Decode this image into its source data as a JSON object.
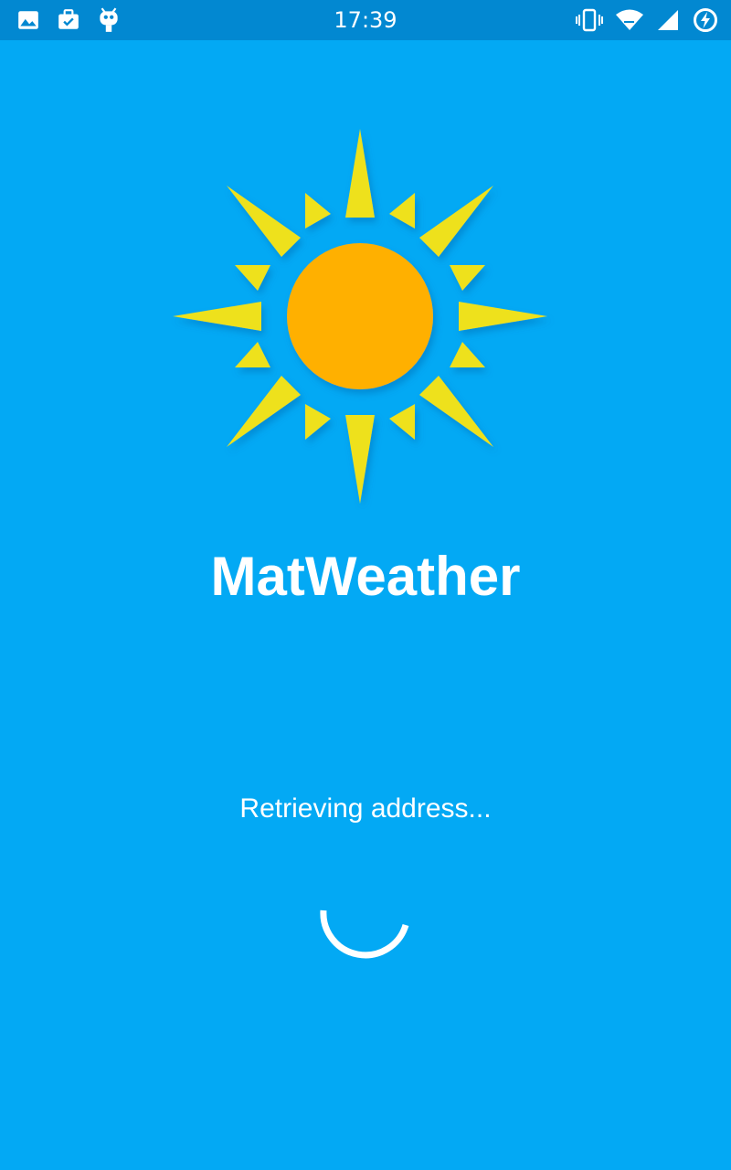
{
  "status_bar": {
    "time": "17:39",
    "left_icons": [
      "image-icon",
      "briefcase-check-icon",
      "cyanogen-mascot-icon"
    ],
    "right_icons": [
      "vibrate-icon",
      "wifi-icon",
      "signal-icon",
      "battery-charging-icon"
    ]
  },
  "app": {
    "name": "MatWeather",
    "status_message": "Retrieving address..."
  },
  "colors": {
    "background": "#03A9F4",
    "status_bar": "#0288D1",
    "sun_core": "#FFB000",
    "sun_rays": "#EEE11E",
    "text": "#FFFFFF"
  }
}
